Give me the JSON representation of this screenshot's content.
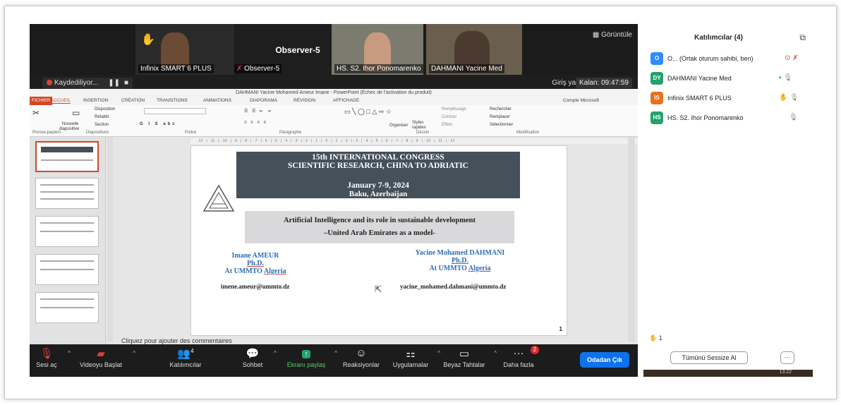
{
  "video": {
    "tiles": [
      {
        "name": "Infinix SMART 6 PLUS"
      },
      {
        "name": "Observer-5"
      },
      {
        "name": "HS. S2. Ihor Ponomarenko"
      },
      {
        "name": "DAHMANI Yacine Med"
      }
    ],
    "center_title": "Observer-5",
    "view_label": "Görüntüle",
    "recording_label": "Kaydediliyor...",
    "signin_label": "Giriş yapın",
    "remaining_label": "Kalan: 09:47:59"
  },
  "ppt": {
    "window_title": "DAHMANI Yacine Mohamed-Ameur Imane - PowerPoint (Échec de l'activation du produit)",
    "tabs": [
      "FICHIER",
      "ACCUEIL",
      "INSERTION",
      "CRÉATION",
      "TRANSITIONS",
      "ANIMATIONS",
      "DIAPORAMA",
      "RÉVISION",
      "AFFICHAGE"
    ],
    "account": "Compte Microsoft",
    "ribbon_groups": [
      "Presse-papiers",
      "Diapositives",
      "Police",
      "Paragraphe",
      "Dessin",
      "Modification"
    ],
    "ribbon_items": {
      "disposition": "Disposition",
      "retablir": "Rétablir",
      "section": "Section",
      "nouvelle": "Nouvelle",
      "diapositive": "diapositive",
      "organiser": "Organiser",
      "styles": "Styles",
      "rapides": "rapides",
      "remplissage": "Remplissage",
      "contour": "Contour",
      "effets": "Effets",
      "rechercher": "Rechercher",
      "remplacer": "Remplacer",
      "selectionner": "Sélectionner"
    },
    "ruler": "· 12 · | · 11 · | · 10 · | · 9 · | · 8 · | · 7 · | · 6 · | · 5 · | · 4 · | · 3 · | · 2 · | · 1 · | · 0 · | · 1 · | · 2 · | · 3 · | · 4 · | · 5 · | · 6 · | · 7 · | · 8 · | · 9 · | · 10 · | · 11 · | · 12 ·",
    "comment_prompt": "Cliquez pour ajouter des commentaires",
    "slide": {
      "band_line1": "15th INTERNATIONAL CONGRESS",
      "band_line2": "SCIENTIFIC RESEARCH, CHINA TO ADRIATIC",
      "date": "January 7-9, 2024",
      "place": "Baku, Azerbaijan",
      "title_line1": "Artificial Intelligence and its role in sustainable development",
      "title_line2": "–United Arab Emirates as a model-",
      "author1": {
        "name": "Imane AMEUR",
        "degree": "Ph.D.",
        "affil_prefix": "At UMMTO ",
        "affil_place": "Algeria",
        "email": "imene.ameur@ummto.dz"
      },
      "author2": {
        "name": "Yacine Mohamed DAHMANI",
        "degree": "Ph.D.",
        "affil_prefix": "At UMMTO ",
        "affil_place": "Algeria",
        "email": "yacine_mohamed.dahmani@ummto.dz"
      },
      "page_number": "1"
    }
  },
  "toolbar": {
    "mute": "Sesi aç",
    "video": "Videoyu Başlat",
    "participants": "Katılımcılar",
    "participants_count": "4",
    "chat": "Sohbet",
    "share": "Ekranı paylaş",
    "reactions": "Reaksiyonlar",
    "apps": "Uygulamalar",
    "whiteboard": "Beyaz Tahtalar",
    "more": "Daha fazla",
    "more_badge": "2",
    "leave": "Odadan Çık"
  },
  "panel": {
    "title": "Katılımcılar (4)",
    "participants": [
      {
        "initials": "O",
        "name": "O... (Ortak oturum sahibi, ben)",
        "color": "#2d8cff"
      },
      {
        "initials": "DY",
        "name": "DAHMANI Yacine Med",
        "color": "#23a26d"
      },
      {
        "initials": "IS",
        "name": "Infinix SMART 6 PLUS",
        "color": "#e5731f"
      },
      {
        "initials": "HS",
        "name": "HS. S2. Ihor Ponomarenko",
        "color": "#23a26d"
      }
    ],
    "raised_hands": "1",
    "mute_all": "Tümünü Sessize Al",
    "more": "···",
    "clock": "13:22"
  },
  "colors": {
    "accent": "#0e72ed",
    "ppt": "#d24726",
    "share_green": "#4fd06a",
    "hand": "#f3b700"
  }
}
